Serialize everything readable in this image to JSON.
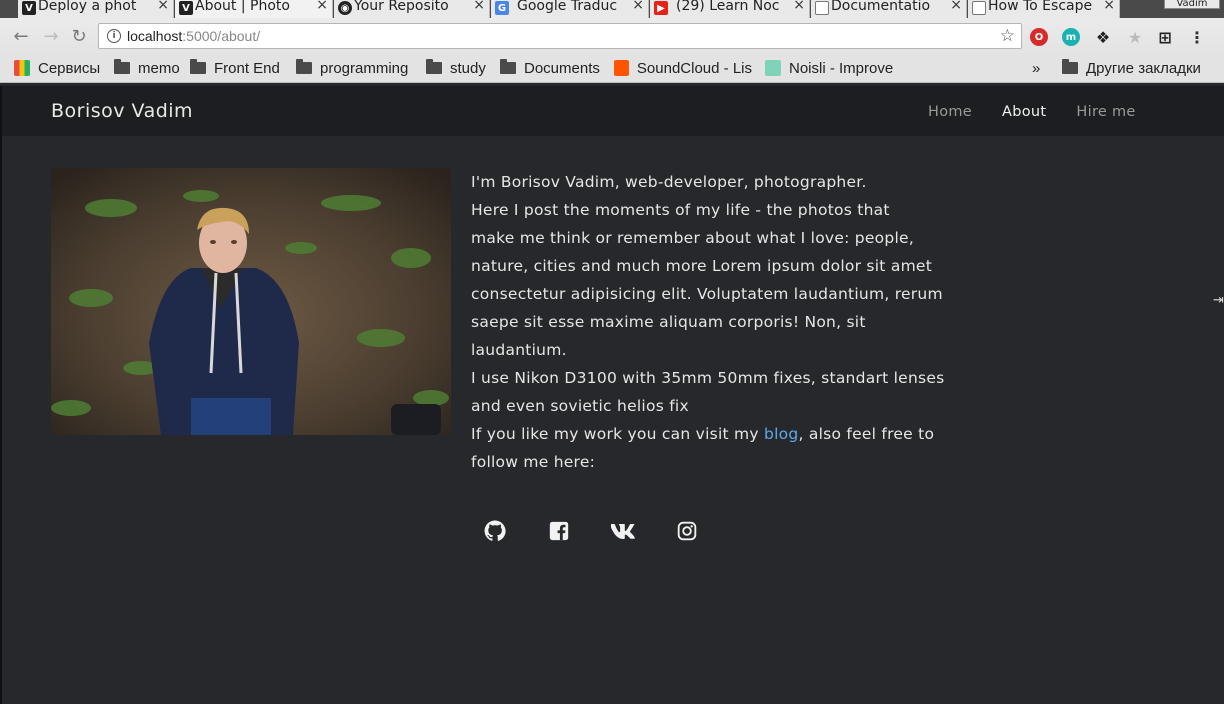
{
  "browser": {
    "tabs": [
      {
        "title": "Deploy a phot",
        "favicon": "v-icon"
      },
      {
        "title": "About | Photo",
        "favicon": "v-icon"
      },
      {
        "title": "Your Reposito",
        "favicon": "github-icon"
      },
      {
        "title": "Google Traduc",
        "favicon": "google-translate-icon"
      },
      {
        "title": "(29) Learn Noc",
        "favicon": "youtube-icon"
      },
      {
        "title": "Documentatio",
        "favicon": "doc-icon"
      },
      {
        "title": "How To Escape",
        "favicon": "doc-icon"
      }
    ],
    "profile_name": "Vadim",
    "url_host": "localhost",
    "url_rest": ":5000/about/",
    "bookmarks": [
      {
        "label": "Сервисы",
        "icon": "apps-icon"
      },
      {
        "label": "memo",
        "icon": "folder-icon"
      },
      {
        "label": "Front End",
        "icon": "folder-icon"
      },
      {
        "label": "programming",
        "icon": "folder-icon"
      },
      {
        "label": "study",
        "icon": "folder-icon"
      },
      {
        "label": "Documents",
        "icon": "folder-icon"
      },
      {
        "label": "SoundCloud - Lis",
        "icon": "soundcloud-icon"
      },
      {
        "label": "Noisli - Improve",
        "icon": "noisli-icon"
      }
    ],
    "more_chevron": "»",
    "other_bookmarks": "Другие закладки"
  },
  "site": {
    "brand": "Borisov Vadim",
    "nav": [
      "Home",
      "About",
      "Hire me"
    ],
    "active_nav": "About"
  },
  "about": {
    "lines": [
      "I'm Borisov Vadim, web-developer, photographer.",
      "Here I post the moments of my life - the photos that",
      "make me think or remember about what I love: people,",
      "nature, cities and much more Lorem ipsum dolor sit amet",
      "consectetur adipisicing elit. Voluptatem laudantium, rerum",
      "saepe sit esse maxime aliquam corporis! Non, sit",
      "laudantium.",
      "I use Nikon D3100 with 35mm 50mm fixes, standart lenses",
      "and even sovietic helios fix"
    ],
    "blog_prefix": "If you like my work you can visit my ",
    "blog_link": "blog",
    "blog_suffix": ", also feel free to",
    "last_line": "follow me here:"
  },
  "social": [
    "github-icon",
    "facebook-icon",
    "vk-icon",
    "instagram-icon"
  ],
  "colors": {
    "page_bg": "#27282c",
    "nav_bg": "#1d1e21",
    "link": "#5fa9e6"
  }
}
